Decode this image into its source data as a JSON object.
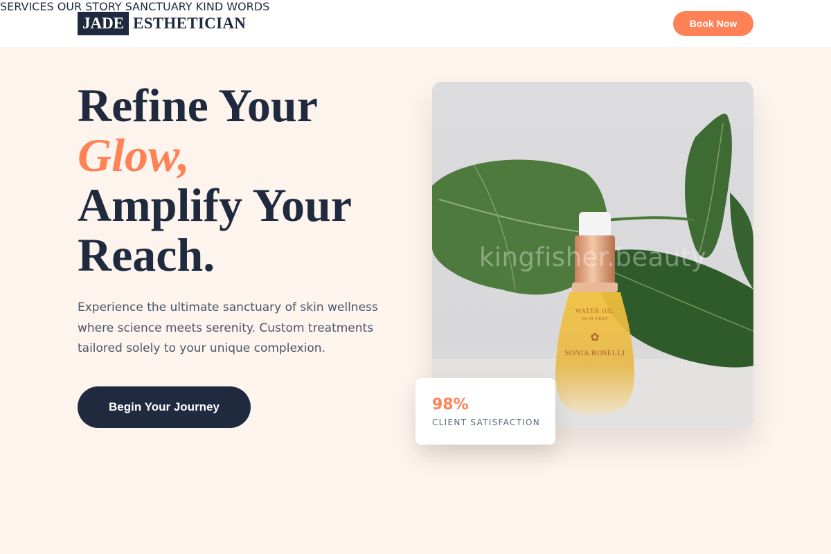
{
  "header": {
    "logo_box": "JADE",
    "logo_text": "ESTHETICIAN",
    "nav": [
      {
        "label": "SERVICES"
      },
      {
        "label": "OUR STORY"
      },
      {
        "label": "SANCTUARY"
      },
      {
        "label": "KIND WORDS"
      }
    ],
    "cta_label": "Book Now"
  },
  "hero": {
    "title_line1": "Refine Your",
    "title_accent": "Glow,",
    "title_line3": "Amplify Your",
    "title_line4": "Reach.",
    "description": "Experience the ultimate sanctuary of skin wellness where science meets serenity. Custom treatments tailored solely to your unique complexion.",
    "cta_label": "Begin Your Journey"
  },
  "image": {
    "watermark": "kingfisher.beauty",
    "product_label_1": "WATER OIL",
    "product_label_2": "SKIN PREP",
    "product_brand": "SONIA ROSELLI"
  },
  "stat": {
    "value": "98%",
    "label": "CLIENT SATISFACTION"
  },
  "colors": {
    "accent": "#ff8156",
    "navy": "#1f2a3f",
    "background": "#fdf4ee"
  }
}
